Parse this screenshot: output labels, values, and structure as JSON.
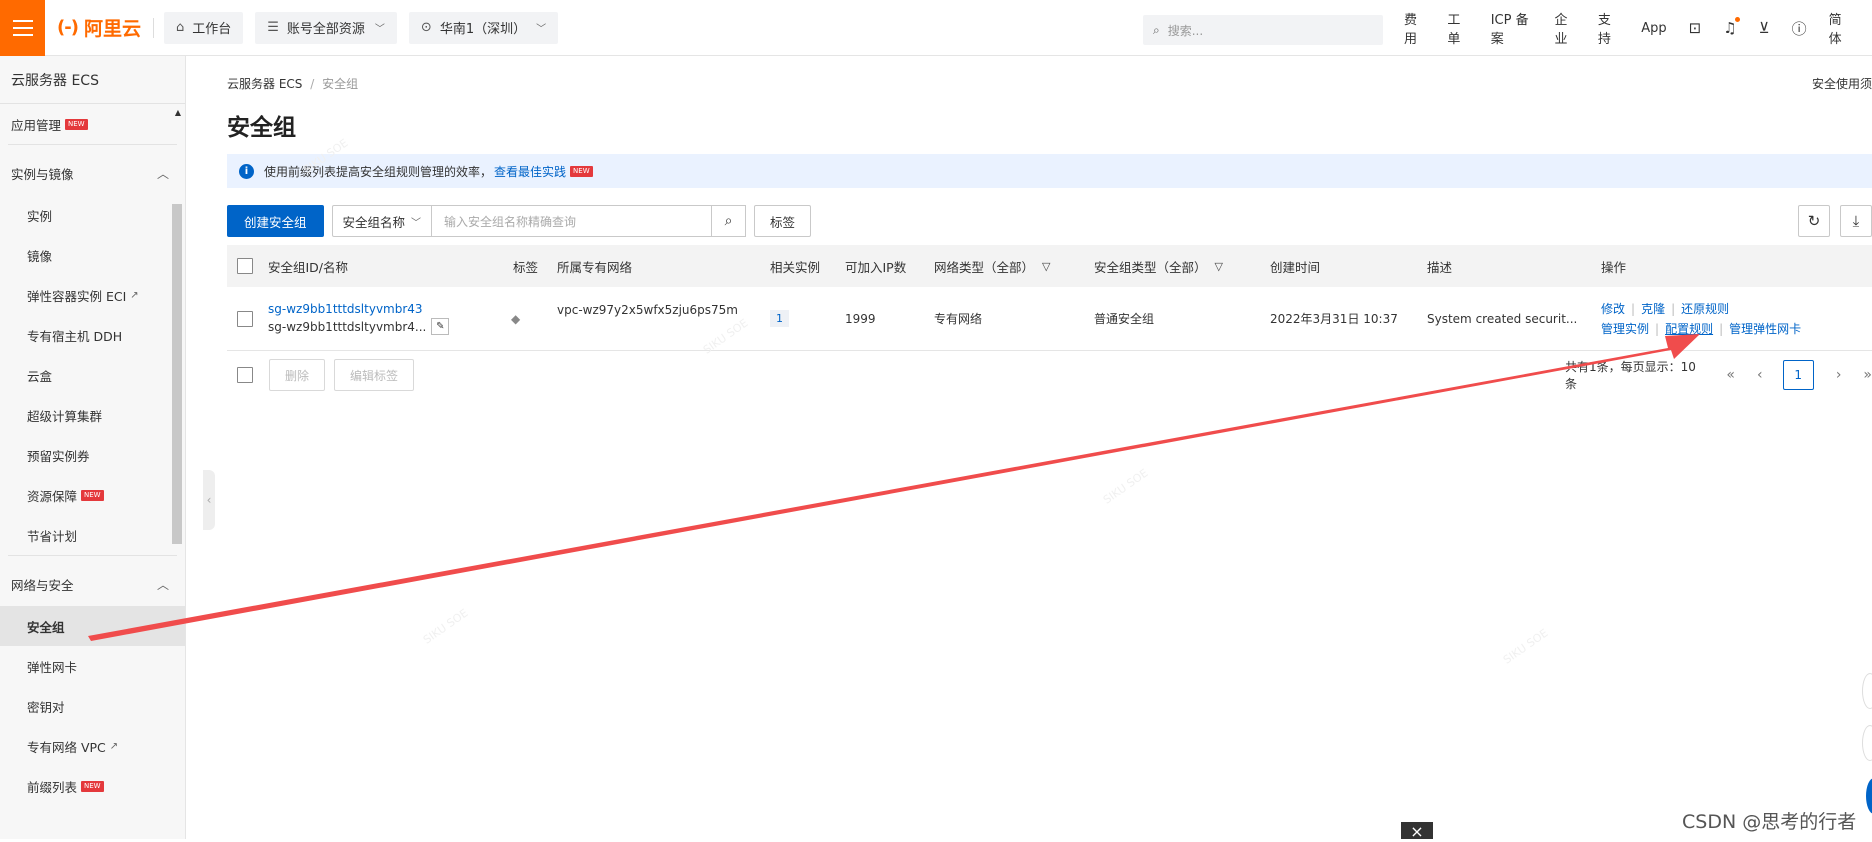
{
  "topbar": {
    "logo_text": "阿里云",
    "logo_mark": "(-)",
    "workbench": "工作台",
    "account_resources": "账号全部资源",
    "region": "华南1（深圳）",
    "search_placeholder": "搜索...",
    "nav": [
      "费用",
      "工单",
      "ICP 备案",
      "企业",
      "支持",
      "App"
    ],
    "lang": "简体"
  },
  "sidebar": {
    "title": "云服务器 ECS",
    "app_mgmt": "应用管理",
    "new_tag": "NEW",
    "groups": [
      {
        "label": "实例与镜像",
        "items": [
          {
            "label": "实例"
          },
          {
            "label": "镜像"
          },
          {
            "label": "弹性容器实例 ECI",
            "ext": true
          },
          {
            "label": "专有宿主机 DDH"
          },
          {
            "label": "云盒"
          },
          {
            "label": "超级计算集群"
          },
          {
            "label": "预留实例券"
          },
          {
            "label": "资源保障",
            "new": true
          },
          {
            "label": "节省计划"
          }
        ]
      },
      {
        "label": "网络与安全",
        "items": [
          {
            "label": "安全组",
            "active": true
          },
          {
            "label": "弹性网卡"
          },
          {
            "label": "密钥对"
          },
          {
            "label": "专有网络 VPC",
            "ext": true
          },
          {
            "label": "前缀列表",
            "new": true
          }
        ]
      }
    ]
  },
  "main": {
    "breadcrumb": [
      "云服务器 ECS",
      "安全组"
    ],
    "help_link": "安全使用须",
    "title": "安全组",
    "notice": {
      "text": "使用前缀列表提高安全组规则管理的效率，",
      "link": "查看最佳实践"
    },
    "toolbar": {
      "create": "创建安全组",
      "search_field": "安全组名称",
      "search_placeholder": "输入安全组名称精确查询",
      "tag_btn": "标签"
    },
    "table": {
      "headers": [
        "安全组ID/名称",
        "标签",
        "所属专有网络",
        "相关实例",
        "可加入IP数",
        "网络类型（全部）",
        "安全组类型（全部）",
        "创建时间",
        "描述",
        "操作"
      ],
      "rows": [
        {
          "id": "sg-wz9bb1tttdsltyvmbr43",
          "name": "sg-wz9bb1tttdsltyvmbr4...",
          "vpc": "vpc-wz97y2x5wfx5zju6ps75m",
          "instances": "1",
          "ip_count": "1999",
          "net_type": "专有网络",
          "sg_type": "普通安全组",
          "created": "2022年3月31日 10:37",
          "desc": "System created securit...",
          "ops_line1": [
            "修改",
            "克隆",
            "还原规则"
          ],
          "ops_line2": [
            "管理实例",
            "配置规则",
            "管理弹性网卡"
          ]
        }
      ]
    },
    "footer": {
      "delete": "删除",
      "edit_tags": "编辑标签",
      "summary": "共有1条，每页显示：10条",
      "page": "1"
    }
  },
  "watermark": "SIKU SOE",
  "csdn_credit": "CSDN @思考的行者",
  "colors": {
    "brand": "#ff6a00",
    "primary": "#0064c8",
    "arrow": "#f04c4c"
  }
}
